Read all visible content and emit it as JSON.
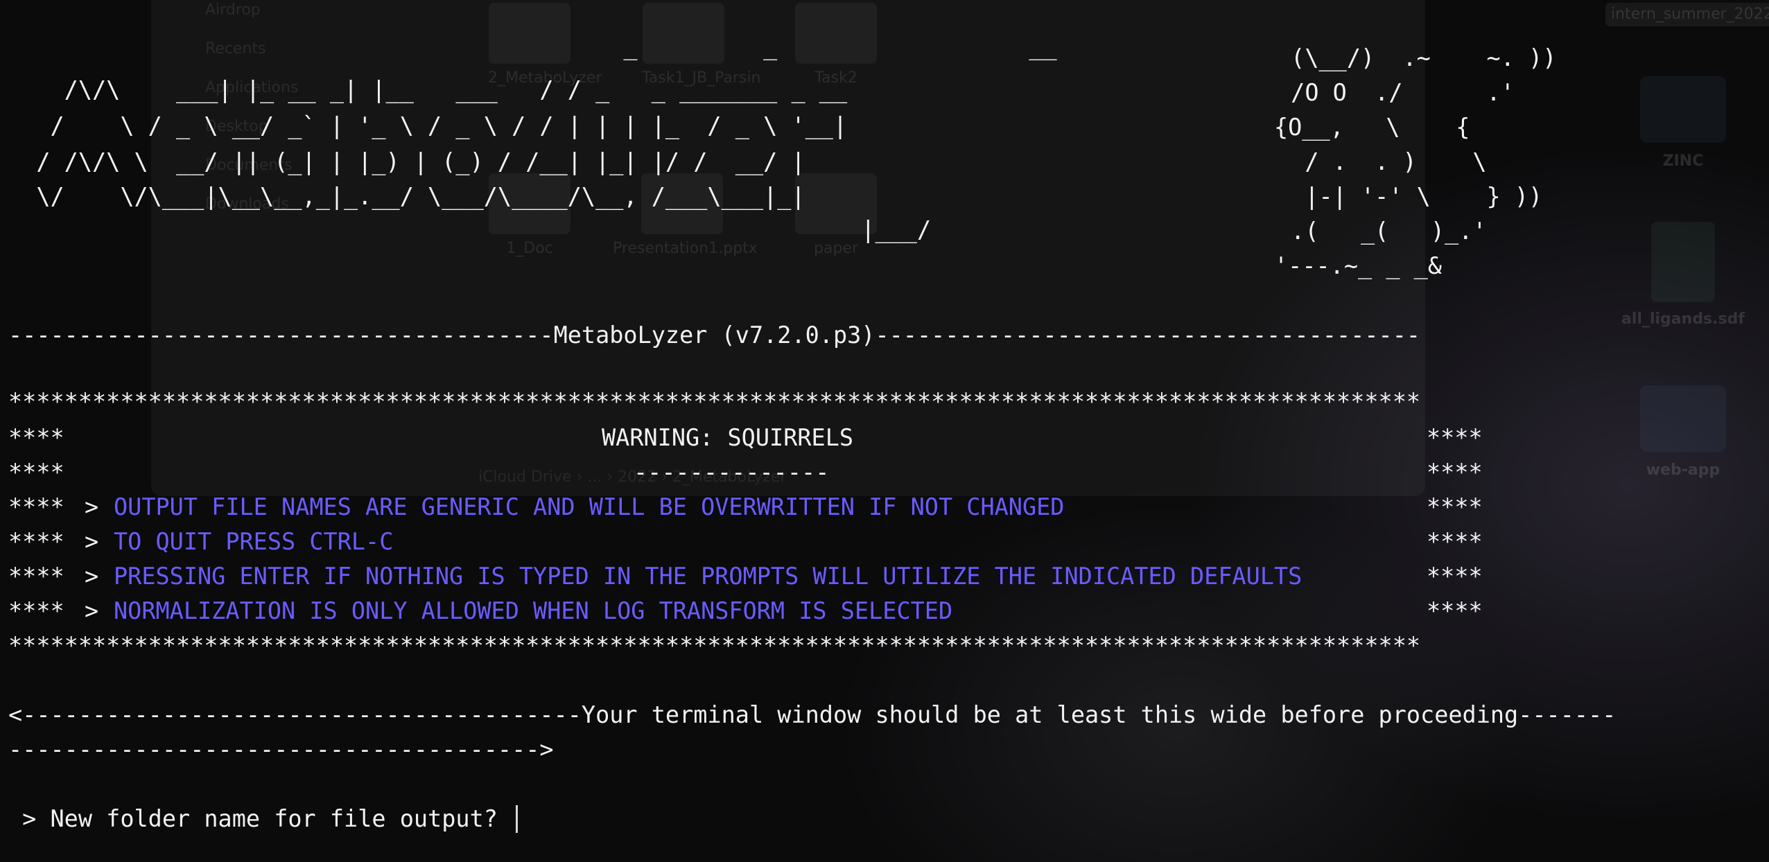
{
  "colors": {
    "background": "#0b0b0c",
    "text": "#f2f2f2",
    "warning_accent": "#6a5cff"
  },
  "background_apps": {
    "finder": {
      "sidebar_items": [
        "Airdrop",
        "Recents",
        "Applications",
        "Desktop",
        "Documents",
        "Downloads"
      ],
      "files": [
        "2_MetaboLyzer",
        "Task1_JB_Parsin",
        "Task2",
        "1_Doc",
        "Presentation1.pptx",
        "paper"
      ],
      "path": "iCloud Drive › ... › 2022 › 2_MetaboLyzer"
    },
    "desktop": {
      "items": [
        "ZINC",
        "all_ligands.sdf",
        "web-app"
      ],
      "tag": "intern_summer_2022"
    }
  },
  "terminal": {
    "banner_title": "MetaboLyzer",
    "banner_ascii": [
      "                                            _         _                  __",
      "    /\\/\\    ___| |_ __ _| |__   ___   / / _   _ _______ _ __",
      "   /    \\ / _ \\ __/ _` | '_ \\ / _ \\ / / | | | |_  / _ \\ '__|",
      "  / /\\/\\ \\  __/ || (_| | |_) | (_) / /__| |_| |/ /  __/ |",
      "  \\/    \\/\\___|\\__\\__,_|_.__/ \\___/\\____/\\__, /___\\___|_|",
      "                                                             |___/"
    ],
    "mascot_ascii": [
      " (\\__/)  .~    ~. ))",
      " /O O  ./      .'",
      "{O__,   \\    {",
      "  / .  . )    \\",
      "  |-| '-' \\    } ))",
      " .(   _(   )_.'",
      "'---.~_ _ _&"
    ],
    "version_line": "---------------------------------------MetaboLyzer (v7.2.0.p3)---------------------------------------",
    "stars_line": "*****************************************************************************************************",
    "warning_box": {
      "left_border": "****",
      "right_border": "****",
      "arrow": ">",
      "title": "WARNING: SQUIRRELS",
      "title_underline": "--------------",
      "messages": [
        "OUTPUT FILE NAMES ARE GENERIC AND WILL BE OVERWRITTEN IF NOT CHANGED",
        "TO QUIT PRESS CTRL-C",
        "PRESSING ENTER IF NOTHING IS TYPED IN THE PROMPTS WILL UTILIZE THE INDICATED DEFAULTS",
        "NORMALIZATION IS ONLY ALLOWED WHEN LOG TRANSFORM IS SELECTED"
      ]
    },
    "width_ruler_line1": "<----------------------------------------Your terminal window should be at least this wide before proceeding-------",
    "width_ruler_line2": "-------------------------------------->",
    "prompt_text": " > New folder name for file output?",
    "input_value": ""
  }
}
